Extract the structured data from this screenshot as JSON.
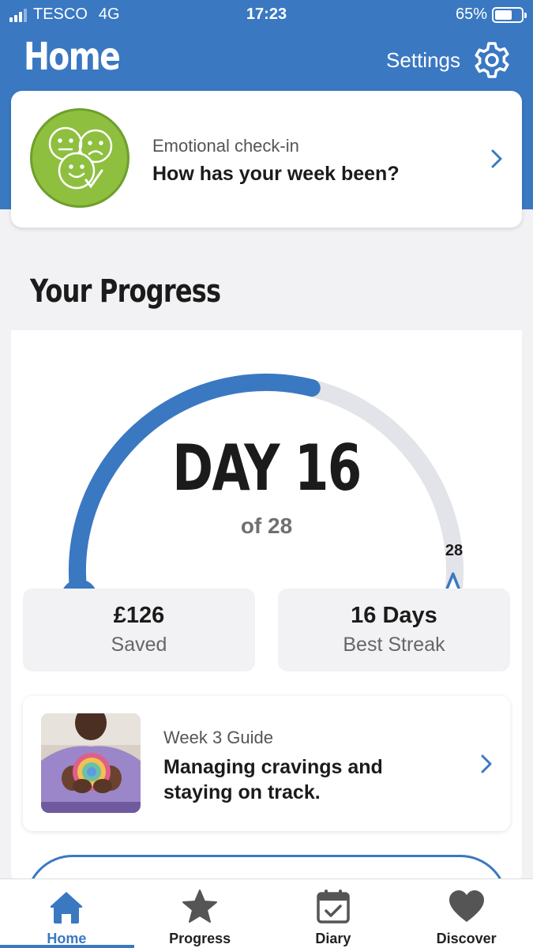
{
  "status_bar": {
    "carrier": "TESCO",
    "network": "4G",
    "time": "17:23",
    "battery": "65%",
    "battery_level": 0.65
  },
  "header": {
    "title": "Home",
    "settings_label": "Settings"
  },
  "checkin": {
    "subtitle": "Emotional check-in",
    "title": "How has your week been?"
  },
  "progress": {
    "title": "Your Progress",
    "day": "DAY 16",
    "of": "of 28",
    "goal": "28",
    "current_day": 16,
    "total_days": 28,
    "stats": [
      {
        "value": "£126",
        "label": "Saved"
      },
      {
        "value": "16 Days",
        "label": "Best Streak"
      }
    ],
    "guide": {
      "subtitle": "Week 3 Guide",
      "title_line1": "Managing cravings and",
      "title_line2": "staying on track."
    }
  },
  "tabs": [
    {
      "label": "Home",
      "icon": "home-icon",
      "active": true
    },
    {
      "label": "Progress",
      "icon": "star-icon",
      "active": false
    },
    {
      "label": "Diary",
      "icon": "calendar-icon",
      "active": false
    },
    {
      "label": "Discover",
      "icon": "heart-icon",
      "active": false
    }
  ],
  "colors": {
    "accent": "#3a78c2",
    "checkin_green": "#8ebf3f",
    "track_grey": "#e3e4e9"
  }
}
